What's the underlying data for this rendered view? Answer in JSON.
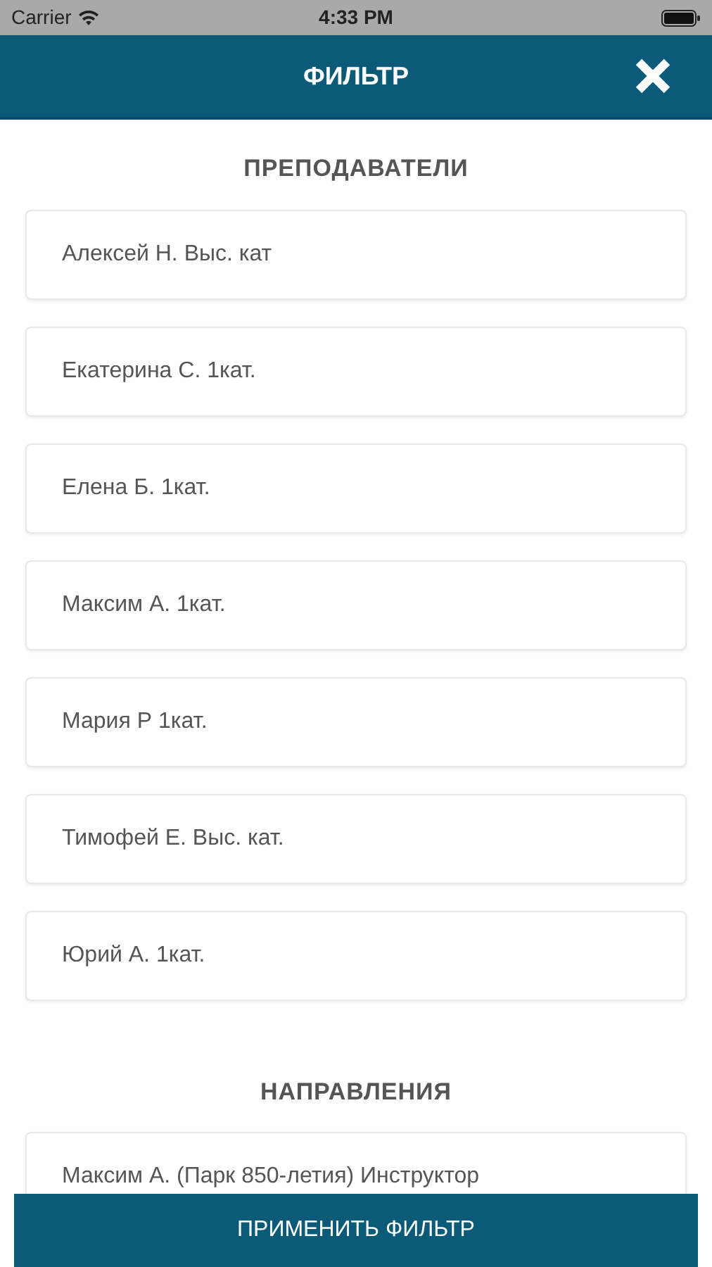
{
  "status_bar": {
    "carrier": "Carrier",
    "time": "4:33 PM"
  },
  "header": {
    "title": "ФИЛЬТР"
  },
  "sections": [
    {
      "title": "ПРЕПОДАВАТЕЛИ",
      "items": [
        {
          "label": "Алексей Н. Выс. кат"
        },
        {
          "label": "Екатерина С. 1кат."
        },
        {
          "label": "Елена Б. 1кат."
        },
        {
          "label": "Максим А. 1кат."
        },
        {
          "label": "Мария Р 1кат."
        },
        {
          "label": "Тимофей Е. Выс. кат."
        },
        {
          "label": "Юрий А. 1кат."
        }
      ]
    },
    {
      "title": "НАПРАВЛЕНИЯ",
      "items": [
        {
          "label": "Максим А. (Парк 850-летия) Инструктор"
        }
      ]
    }
  ],
  "apply_button": "ПРИМЕНИТЬ ФИЛЬТР"
}
